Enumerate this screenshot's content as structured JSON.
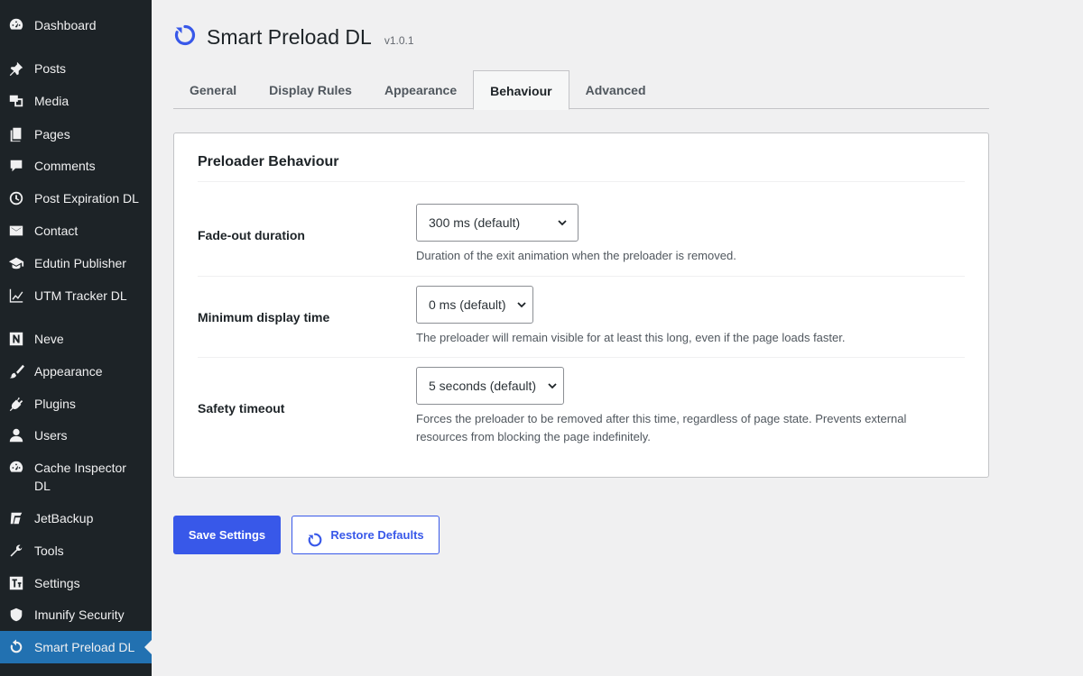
{
  "sidebar": {
    "items": [
      {
        "label": "Dashboard",
        "icon": "dashboard-icon"
      },
      {
        "label": "Posts",
        "icon": "pushpin-icon"
      },
      {
        "label": "Media",
        "icon": "media-icon"
      },
      {
        "label": "Pages",
        "icon": "page-icon"
      },
      {
        "label": "Comments",
        "icon": "comment-icon"
      },
      {
        "label": "Post Expiration DL",
        "icon": "clock-icon"
      },
      {
        "label": "Contact",
        "icon": "envelope-icon"
      },
      {
        "label": "Edutin Publisher",
        "icon": "graduation-cap-icon"
      },
      {
        "label": "UTM Tracker DL",
        "icon": "chart-line-icon"
      },
      {
        "label": "Neve",
        "icon": "neve-logo-icon"
      },
      {
        "label": "Appearance",
        "icon": "paintbrush-icon"
      },
      {
        "label": "Plugins",
        "icon": "plugin-icon"
      },
      {
        "label": "Users",
        "icon": "user-icon"
      },
      {
        "label": "Cache Inspector DL",
        "icon": "dashboard-icon"
      },
      {
        "label": "JetBackup",
        "icon": "jetbackup-icon"
      },
      {
        "label": "Tools",
        "icon": "wrench-icon"
      },
      {
        "label": "Settings",
        "icon": "settings-icon"
      },
      {
        "label": "Imunify Security",
        "icon": "shield-icon"
      },
      {
        "label": "Smart Preload DL",
        "icon": "refresh-icon"
      }
    ]
  },
  "header": {
    "title": "Smart Preload DL",
    "version": "v1.0.1"
  },
  "tabs": [
    {
      "label": "General"
    },
    {
      "label": "Display Rules"
    },
    {
      "label": "Appearance"
    },
    {
      "label": "Behaviour"
    },
    {
      "label": "Advanced"
    }
  ],
  "card": {
    "title": "Preloader Behaviour",
    "rows": [
      {
        "label": "Fade-out duration",
        "value": "300 ms (default)",
        "description": "Duration of the exit animation when the preloader is removed."
      },
      {
        "label": "Minimum display time",
        "value": "0 ms (default)",
        "description": "The preloader will remain visible for at least this long, even if the page loads faster."
      },
      {
        "label": "Safety timeout",
        "value": "5 seconds (default)",
        "description": "Forces the preloader to be removed after this time, regardless of page state. Prevents external resources from blocking the page indefinitely."
      }
    ]
  },
  "actions": {
    "save_label": "Save Settings",
    "restore_label": "Restore Defaults"
  },
  "colors": {
    "sidebar_bg": "#1d2327",
    "accent": "#3858e9",
    "active_menu": "#2271b1"
  }
}
